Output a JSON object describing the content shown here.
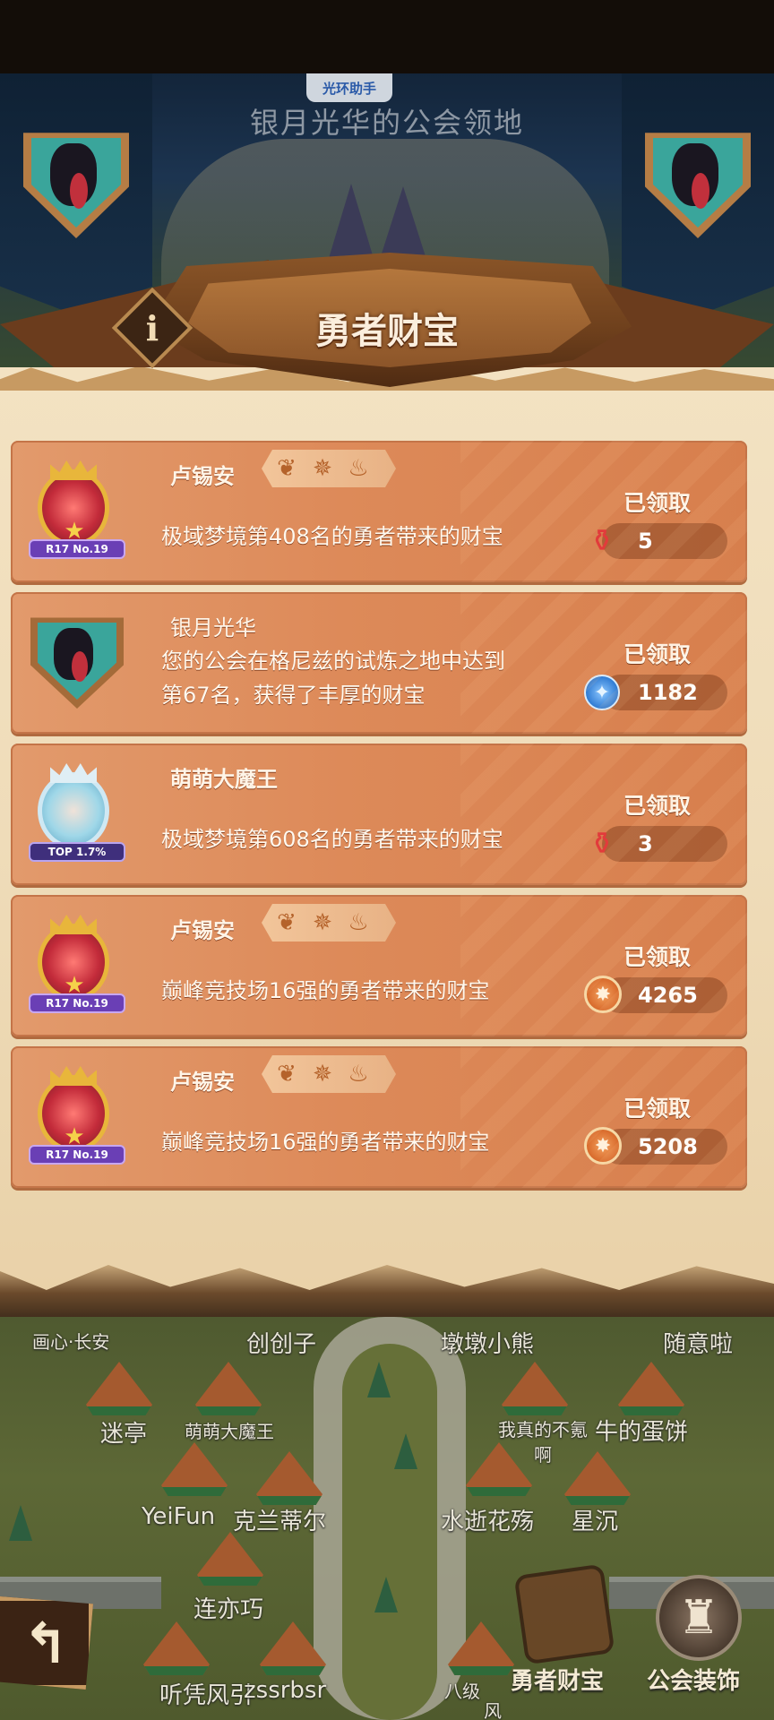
{
  "assistant_pill": "光环助手",
  "territory_title": "银月光华的公会领地",
  "panel_title": "勇者财宝",
  "info_glyph": "i",
  "rows": [
    {
      "player_name": "卢锡安",
      "avatar_tag": "R17 No.19",
      "desc_line1": "极域梦境第408名的勇者带来的财宝",
      "desc_line2": "",
      "status": "已领取",
      "reward_icon": "red-potion-icon",
      "reward_value": "5"
    },
    {
      "player_name": "银月光华",
      "avatar_tag": "",
      "desc_line1": "您的公会在格尼兹的试炼之地中达到",
      "desc_line2": "第67名，获得了丰厚的财宝",
      "status": "已领取",
      "reward_icon": "blue-gem-coin-icon",
      "reward_value": "1182"
    },
    {
      "player_name": "萌萌大魔王",
      "avatar_tag": "TOP 1.7%",
      "desc_line1": "极域梦境第608名的勇者带来的财宝",
      "desc_line2": "",
      "status": "已领取",
      "reward_icon": "red-potion-icon",
      "reward_value": "3"
    },
    {
      "player_name": "卢锡安",
      "avatar_tag": "R17 No.19",
      "desc_line1": "巅峰竞技场16强的勇者带来的财宝",
      "desc_line2": "",
      "status": "已领取",
      "reward_icon": "orange-arena-coin-icon",
      "reward_value": "4265"
    },
    {
      "player_name": "卢锡安",
      "avatar_tag": "R17 No.19",
      "desc_line1": "巅峰竞技场16强的勇者带来的财宝",
      "desc_line2": "",
      "status": "已领取",
      "reward_icon": "orange-arena-coin-icon",
      "reward_value": "5208"
    }
  ],
  "map_labels": [
    "画心·长安",
    "创创子",
    "墩墩小熊",
    "随意啦",
    "迷亭",
    "萌萌大魔王",
    "我真的不氪",
    "啊",
    "牛的蛋饼",
    "YeiFun",
    "克兰蒂尔",
    "水逝花殇",
    "星沉",
    "连亦巧",
    "听凭风引",
    "zssrbsr",
    "八级",
    "风"
  ],
  "bottom_buttons": {
    "back_glyph": "↰",
    "hero_treasure_label": "勇者财宝",
    "decor_glyph": "♜",
    "decor_label": "公会装饰"
  }
}
